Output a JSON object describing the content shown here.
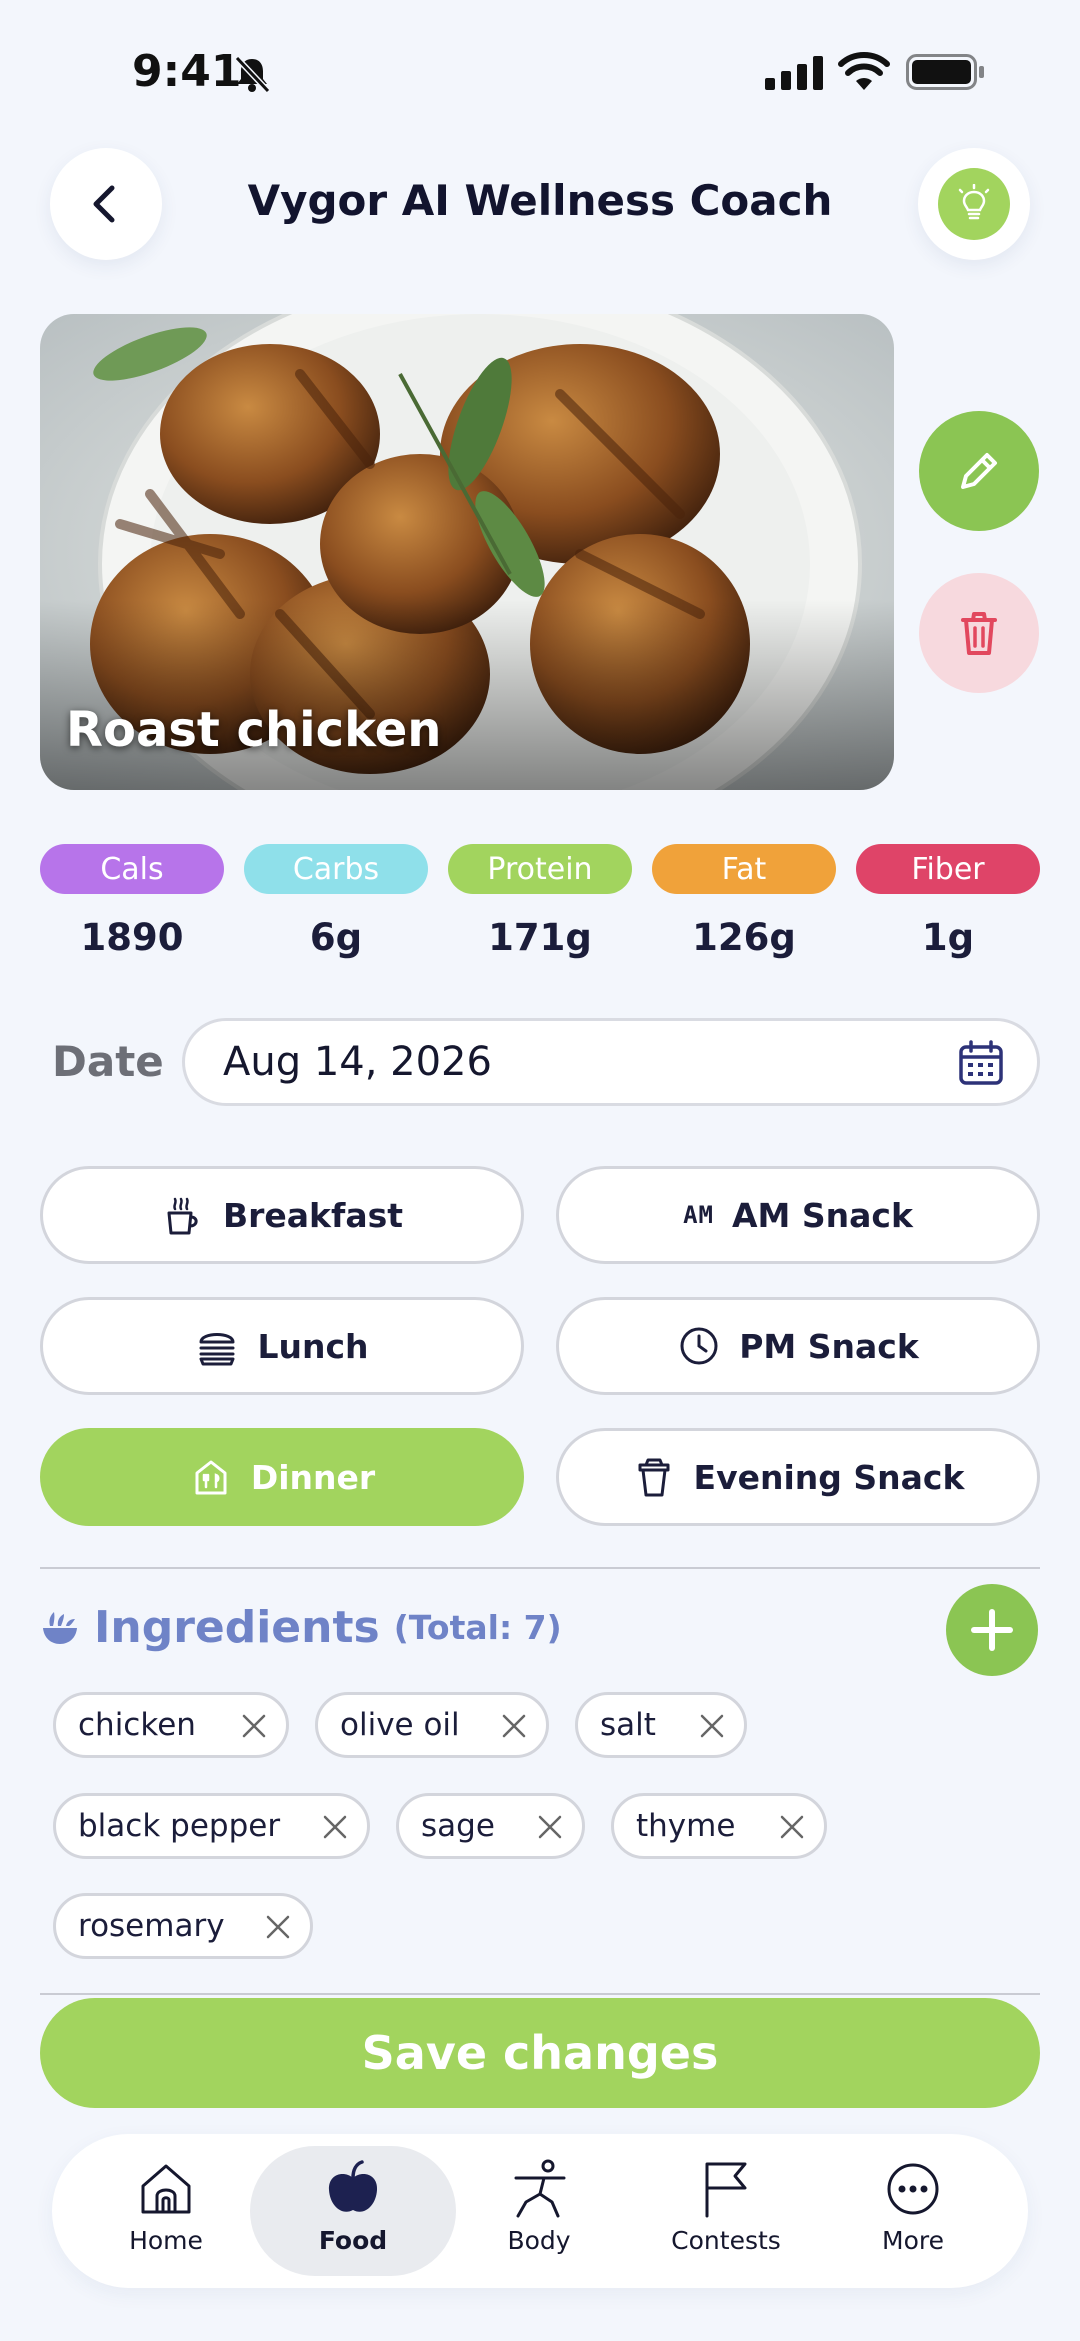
{
  "status_bar": {
    "time": "9:41"
  },
  "header": {
    "title": "Vygor AI Wellness Coach"
  },
  "food": {
    "name": "Roast chicken"
  },
  "nutrients": [
    {
      "label": "Cals",
      "value": "1890",
      "color": "#b774ea"
    },
    {
      "label": "Carbs",
      "value": "6g",
      "color": "#8fe0ea"
    },
    {
      "label": "Protein",
      "value": "171g",
      "color": "#a2d45e"
    },
    {
      "label": "Fat",
      "value": "126g",
      "color": "#f0a23a"
    },
    {
      "label": "Fiber",
      "value": "1g",
      "color": "#df4468"
    }
  ],
  "date": {
    "label": "Date",
    "value": "Aug 14, 2026"
  },
  "meals": {
    "breakfast": "Breakfast",
    "am_snack": "AM Snack",
    "am_badge": "AM",
    "lunch": "Lunch",
    "pm_snack": "PM Snack",
    "dinner": "Dinner",
    "evening_snack": "Evening Snack",
    "selected": "Dinner"
  },
  "ingredients": {
    "title": "Ingredients",
    "total": "(Total: 7)",
    "items": [
      "chicken",
      "olive oil",
      "salt",
      "black pepper",
      "sage",
      "thyme",
      "rosemary"
    ]
  },
  "save_label": "Save changes",
  "nav": {
    "home": "Home",
    "food": "Food",
    "body": "Body",
    "contests": "Contests",
    "more": "More",
    "active": "Food"
  },
  "colors": {
    "accent_green": "#a2d45e",
    "ingredients_title": "#6f83c7",
    "delete_bg": "#f7d9de",
    "delete_icon": "#e2485e"
  }
}
